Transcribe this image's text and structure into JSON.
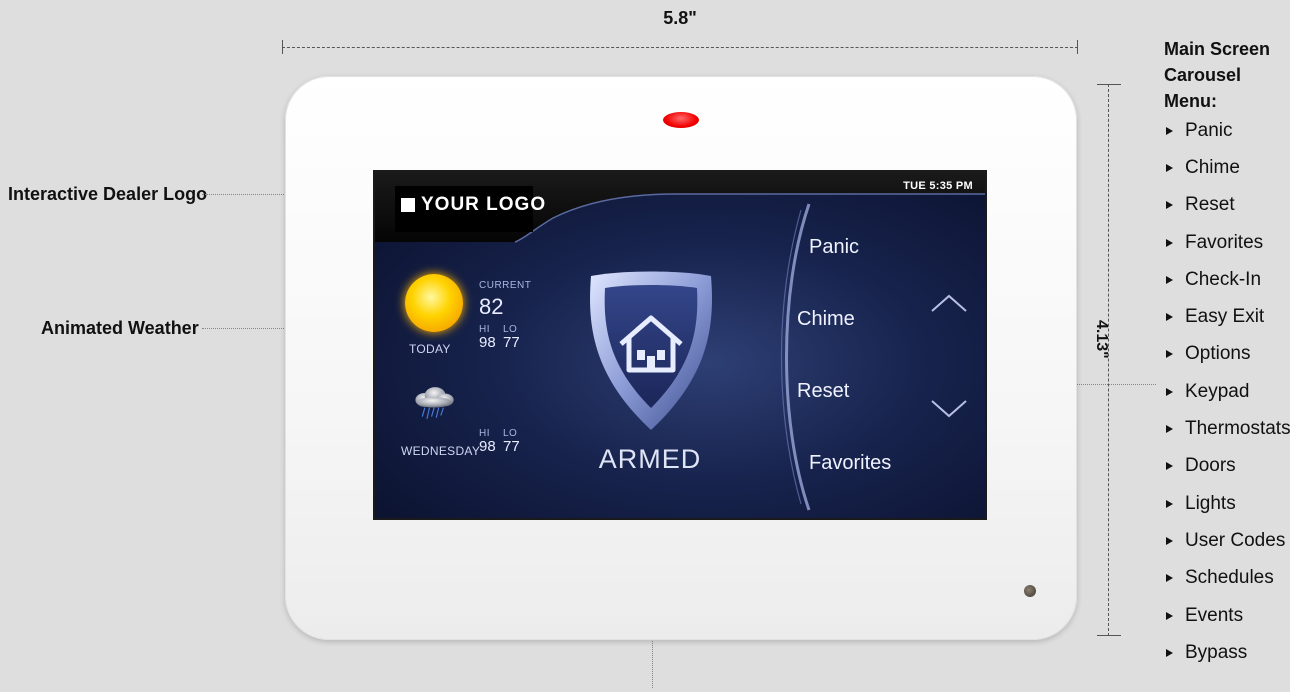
{
  "dimensions": {
    "width_label": "5.8\"",
    "height_label": "4.13\""
  },
  "screen": {
    "logo_text": "YOUR LOGO",
    "clock": "TUE 5:35 PM",
    "weather_today": {
      "current_label": "CURRENT",
      "current_temp": "82",
      "hi_label": "HI",
      "lo_label": "LO",
      "hi": "98",
      "lo": "77",
      "day": "TODAY",
      "icon": "sun-icon"
    },
    "weather_next": {
      "hi_label": "HI",
      "lo_label": "LO",
      "hi": "98",
      "lo": "77",
      "day": "WEDNESDAY",
      "icon": "rain-cloud-icon"
    },
    "status": "ARMED",
    "carousel": [
      "Panic",
      "Chime",
      "Reset",
      "Favorites"
    ]
  },
  "callouts": {
    "logo": "Interactive Dealer Logo",
    "weather": "Animated Weather"
  },
  "menu": {
    "title_line1": "Main Screen",
    "title_line2": "Carousel Menu:",
    "items": [
      "Panic",
      "Chime",
      "Reset",
      "Favorites",
      "Check-In",
      "Easy Exit",
      "Options",
      "Keypad",
      "Thermostats",
      "Doors",
      "Lights",
      "User Codes",
      "Schedules",
      "Events",
      "Bypass"
    ]
  },
  "colors": {
    "led": "#f20000",
    "screen_bg": "#0c1333",
    "device": "#ffffff"
  }
}
